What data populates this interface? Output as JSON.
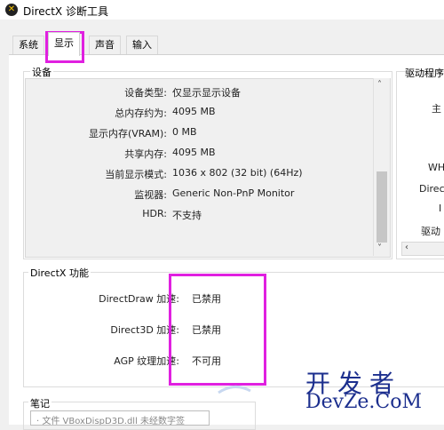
{
  "window": {
    "title": "DirectX 诊断工具"
  },
  "tabs": [
    "系统",
    "显示",
    "声音",
    "输入"
  ],
  "device": {
    "title": "设备",
    "rows": [
      {
        "label": "设备类型:",
        "value": "仅显示显示设备"
      },
      {
        "label": "总内存约为:",
        "value": "4095 MB"
      },
      {
        "label": "显示内存(VRAM):",
        "value": "0 MB"
      },
      {
        "label": "共享内存:",
        "value": "4095 MB"
      },
      {
        "label": "当前显示模式:",
        "value": "1036 x 802 (32 bit) (64Hz)"
      },
      {
        "label": "监视器:",
        "value": "Generic Non-PnP Monitor"
      },
      {
        "label": "HDR:",
        "value": "不支持"
      }
    ]
  },
  "driver": {
    "title": "驱动程序",
    "partials": [
      "主",
      "WH",
      "Direc",
      "I",
      "驱动"
    ]
  },
  "features": {
    "title": "DirectX 功能",
    "rows": [
      {
        "label": "DirectDraw 加速:",
        "value": "已禁用"
      },
      {
        "label": "Direct3D 加速:",
        "value": "已禁用"
      },
      {
        "label": "AGP 纹理加速:",
        "value": "不可用"
      }
    ]
  },
  "notes": {
    "title": "笔记",
    "text": "· 文件 VBoxDispD3D.dll 未经数字签"
  },
  "watermark": {
    "line1": "开发者",
    "line2": "DevZe.CoM"
  },
  "colors": {
    "highlight": "#e020e0",
    "watermark": "#1c2f8e"
  }
}
